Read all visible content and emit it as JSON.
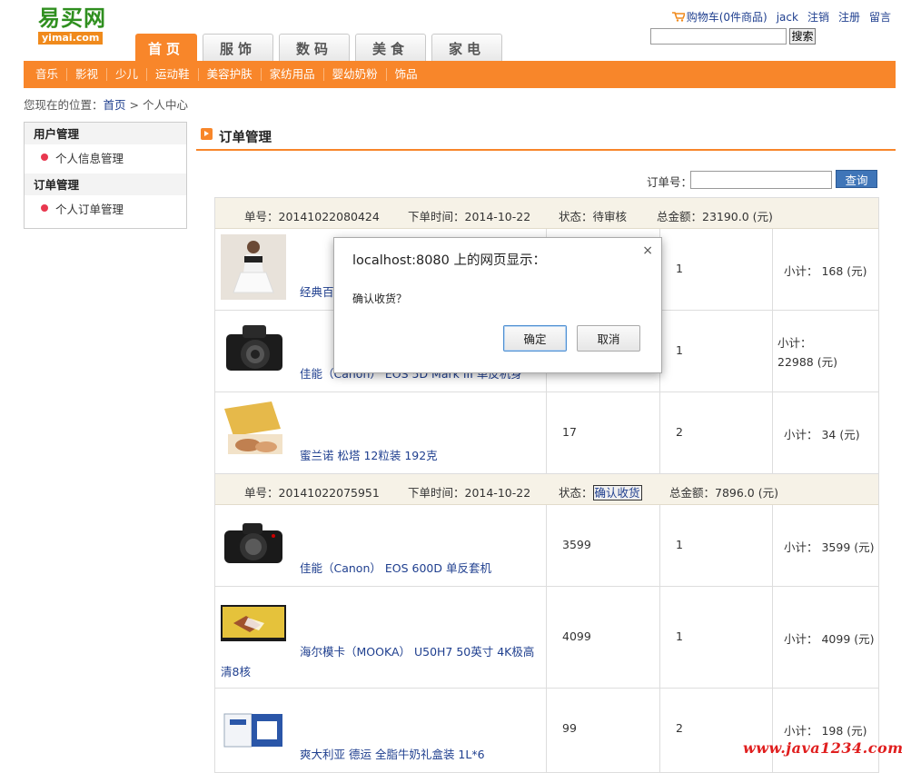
{
  "logo": {
    "cn": "易买网",
    "en": "yimai.com"
  },
  "toplinks": {
    "cart": "购物车(0件商品)",
    "user": "jack",
    "logout": "注销",
    "register": "注册",
    "message": "留言"
  },
  "search": {
    "button": "搜索",
    "value": ""
  },
  "tabs": [
    {
      "label": "首页",
      "active": true
    },
    {
      "label": "服饰"
    },
    {
      "label": "数码"
    },
    {
      "label": "美食"
    },
    {
      "label": "家电"
    }
  ],
  "subnav": [
    "音乐",
    "影视",
    "少儿",
    "运动鞋",
    "美容护肤",
    "家纺用品",
    "婴幼奶粉",
    "饰品"
  ],
  "breadcrumb": {
    "prefix": "您现在的位置：",
    "home": "首页",
    "sep": " > ",
    "current": "个人中心"
  },
  "sidebar": {
    "groups": [
      {
        "title": "用户管理",
        "items": [
          "个人信息管理"
        ]
      },
      {
        "title": "订单管理",
        "items": [
          "个人订单管理"
        ]
      }
    ]
  },
  "main": {
    "title": "订单管理",
    "order_id_label": "订单号：",
    "query_button": "查询"
  },
  "orders": [
    {
      "no_label": "单号：20141022080424",
      "time_label": "下单时间：2014-10-22",
      "status_label": "状态：",
      "status": "待审核",
      "total": "总金额：23190.0 (元)",
      "items": [
        {
          "name": "经典百搭",
          "price": "",
          "qty": "1",
          "subtotal": "小计： 168 (元)"
        },
        {
          "name": "佳能（Canon） EOS 5D Mark III 单反机身",
          "price": "",
          "qty": "1",
          "subtotal_label": "小计：",
          "subtotal_value": "22988 (元)"
        },
        {
          "name": "蜜兰诺 松塔 12粒装 192克",
          "price": "17",
          "qty": "2",
          "subtotal": "小计： 34 (元)"
        }
      ]
    },
    {
      "no_label": "单号：20141022075951",
      "time_label": "下单时间：2014-10-22",
      "status_label": "状态：",
      "status": "确认收货",
      "total": "总金额：7896.0 (元)",
      "items": [
        {
          "name": "佳能（Canon） EOS 600D 单反套机",
          "price": "3599",
          "qty": "1",
          "subtotal": "小计： 3599 (元)"
        },
        {
          "name": "海尔模卡（MOOKA） U50H7 50英寸 4K极高清8核",
          "price": "4099",
          "qty": "1",
          "subtotal": "小计： 4099 (元)"
        },
        {
          "name": "爽大利亚 德运 全脂牛奶礼盒装 1L*6",
          "price": "99",
          "qty": "2",
          "subtotal": "小计： 198 (元)"
        }
      ]
    }
  ],
  "dialog": {
    "title": "localhost:8080 上的网页显示：",
    "message": "确认收货？",
    "close": "×",
    "ok": "确定",
    "cancel": "取消"
  },
  "watermark": "www.java1234.com",
  "colors": {
    "accent": "#f8862a",
    "link": "#1f3f8f",
    "watermark": "#e01e1e"
  }
}
